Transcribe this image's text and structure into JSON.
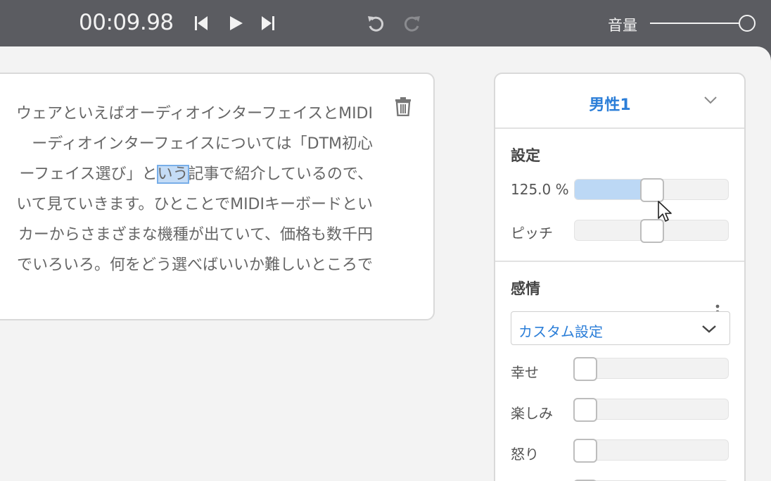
{
  "transport": {
    "time": "00:09.98",
    "volume_label": "音量",
    "volume_level": 1.0
  },
  "icons": [
    "skip-back-icon",
    "play-icon",
    "skip-forward-icon",
    "undo-icon",
    "redo-icon",
    "trash-icon",
    "chevron-down-icon",
    "more-vertical-icon",
    "mouse-cursor-icon"
  ],
  "editor": {
    "lines": [
      "ウェアといえばオーディオインターフェイスとMIDI",
      "ーディオインターフェイスについては「DTM初心",
      "ーフェイス選び」と",
      "いう",
      "記事で紹介しているので、",
      "いて見ていきます。ひとことでMIDIキーボードとい",
      "カーからさまざまな機種が出ていて、価格も数千円",
      "でいろいろ。何をどう選べばいいか難しいところで"
    ]
  },
  "panel": {
    "voice": "男性1",
    "settings": {
      "title": "設定",
      "speed_label": "125.0 %",
      "speed_level": 0.5,
      "pitch_label": "ピッチ",
      "pitch_level": 0.5
    },
    "emotion": {
      "title": "感情",
      "preset": "カスタム設定",
      "items": [
        {
          "label": "幸せ",
          "level": 0
        },
        {
          "label": "楽しみ",
          "level": 0
        },
        {
          "label": "怒り",
          "level": 0
        }
      ]
    }
  },
  "colors": {
    "topbar": "#5b5c61",
    "accent": "#2b7ed8",
    "slider_fill": "#bcd8f5",
    "highlight": "#c4dcf6"
  }
}
